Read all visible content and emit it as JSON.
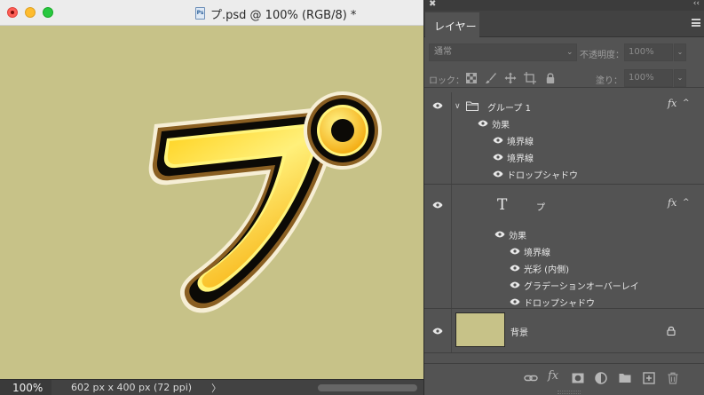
{
  "document": {
    "title": "プ.psd @ 100% (RGB/8) *",
    "file_icon_text": "Ps",
    "zoom": "100%",
    "info": "602 px x 400 px (72 ppi)",
    "info_arrow": "〉",
    "canvas_color": "#c7c288"
  },
  "panel": {
    "close": "✖",
    "collapse": "‹‹",
    "tab": "レイヤー",
    "blend_mode": "通常",
    "opacity_label": "不透明度：",
    "opacity_value": "100%",
    "lock_label": "ロック：",
    "fill_label": "塗り：",
    "fill_value": "100%",
    "dropdown_chevron": "⌄",
    "icons": [
      "lock-transparent-pixels-icon",
      "lock-image-pixels-icon",
      "lock-position-icon",
      "lock-artboard-icon",
      "lock-all-icon"
    ]
  },
  "layers": {
    "group": {
      "name": "グループ 1",
      "fx": "fx",
      "caret": "^",
      "expand": "∨",
      "effects_label": "効果",
      "effects": [
        "境界線",
        "境界線",
        "ドロップシャドウ"
      ]
    },
    "text_layer": {
      "glyph": "T",
      "name": "プ",
      "fx": "fx",
      "caret": "^",
      "effects_label": "効果",
      "effects": [
        "境界線",
        "光彩 (内側)",
        "グラデーションオーバーレイ",
        "ドロップシャドウ"
      ]
    },
    "background": {
      "name": "背景"
    }
  },
  "footer": {
    "icons": [
      "link-layers-icon",
      "add-layer-style-icon",
      "add-mask-icon",
      "adjustment-layer-icon",
      "new-group-icon",
      "new-layer-icon",
      "delete-layer-icon"
    ],
    "fx_text": "fx"
  }
}
